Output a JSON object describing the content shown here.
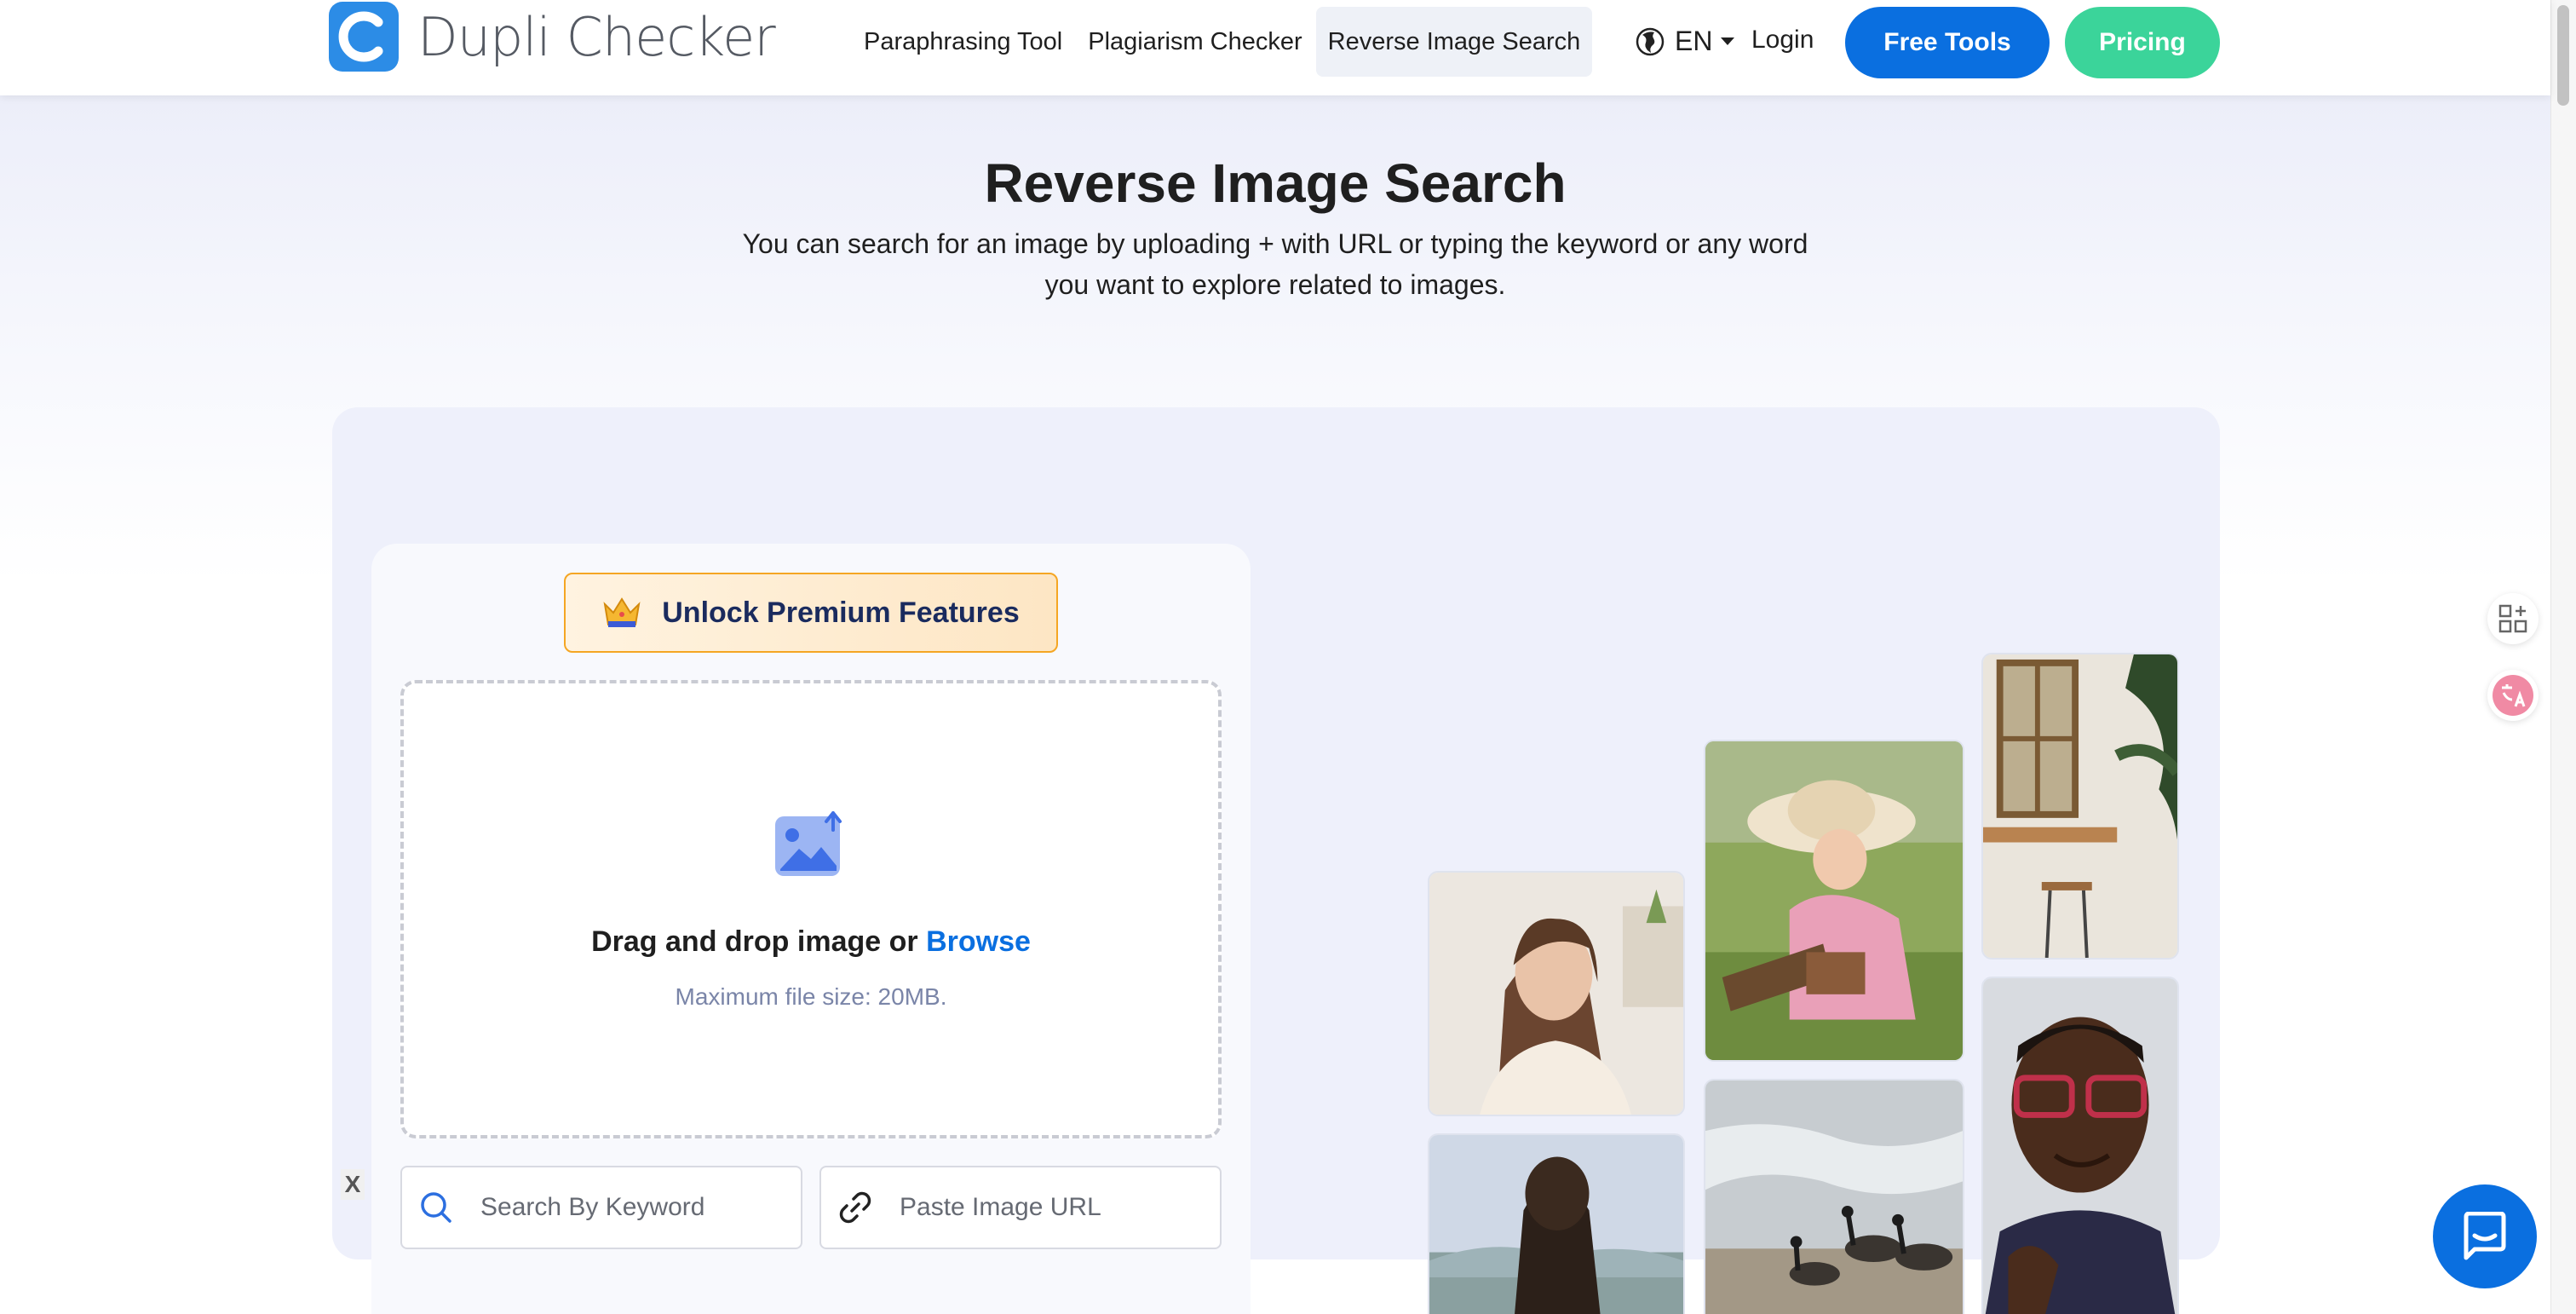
{
  "header": {
    "logo_text": "Dupli Checker",
    "nav": [
      {
        "label": "Paraphrasing Tool",
        "active": false
      },
      {
        "label": "Plagiarism Checker",
        "active": false
      },
      {
        "label": "Reverse Image Search",
        "active": true
      }
    ],
    "language": "EN",
    "login": "Login",
    "free_tools": "Free Tools",
    "pricing": "Pricing"
  },
  "hero": {
    "title": "Reverse Image Search",
    "subtitle_line1": "You can search for an image by uploading + with URL or typing the keyword or any word",
    "subtitle_line2": "you want to explore related to images."
  },
  "panel": {
    "premium_label": "Unlock Premium Features",
    "drag_text": "Drag and drop image or ",
    "browse_text": "Browse",
    "max_size": "Maximum file size: 20MB.",
    "close_label": "X",
    "keyword_placeholder": "Search By Keyword",
    "url_placeholder": "Paste Image URL"
  },
  "colors": {
    "primary": "#0a6fe0",
    "pricing": "#3bd49a",
    "premium_border": "#f5a623"
  },
  "icons": [
    "logo-icon",
    "globe-icon",
    "caret-down-icon",
    "crown-icon",
    "image-upload-icon",
    "search-icon",
    "link-icon",
    "apps-icon",
    "translate-icon",
    "chat-icon"
  ]
}
